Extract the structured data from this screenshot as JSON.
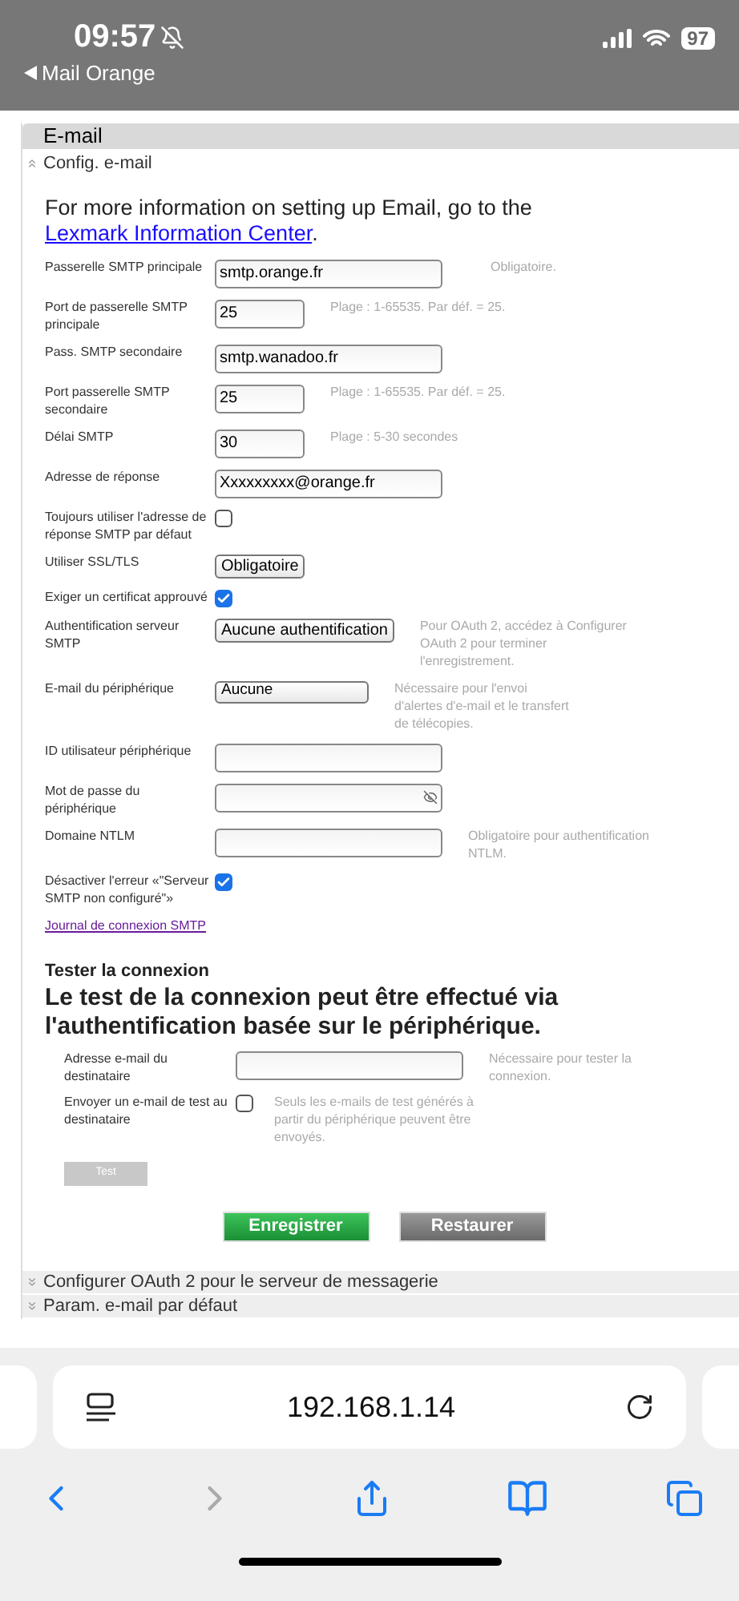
{
  "status_bar": {
    "time": "09:57",
    "back_app": "Mail Orange",
    "battery": "97"
  },
  "page": {
    "title": "E-mail",
    "sections": [
      {
        "title": "Config. e-mail",
        "expanded": true
      }
    ],
    "intro": "For more information on setting up Email, go to the",
    "intro_link": "Lexmark Information Center",
    "intro_end": ".",
    "fields": [
      {
        "label": "Passerelle SMTP principale",
        "kind": "text",
        "value": "smtp.orange.fr",
        "hint": "Obligatoire."
      },
      {
        "label": "Port de passerelle SMTP principale",
        "kind": "number",
        "value": "25",
        "hint": "Plage : 1-65535. Par déf. = 25."
      },
      {
        "label": "Pass. SMTP secondaire",
        "kind": "text",
        "value": "smtp.wanadoo.fr"
      },
      {
        "label": "Port passerelle SMTP secondaire",
        "kind": "number",
        "value": "25",
        "hint": "Plage : 1-65535. Par déf. = 25."
      },
      {
        "label": "Délai SMTP",
        "kind": "number",
        "value": "30",
        "hint": "Plage : 5-30 secondes"
      },
      {
        "label": "Adresse de réponse",
        "kind": "text",
        "value": "Xxxxxxxxx@orange.fr"
      },
      {
        "label": "Toujours utiliser l'adresse de réponse SMTP par défaut",
        "kind": "checkbox",
        "checked": false
      },
      {
        "label": "Utiliser SSL/TLS",
        "kind": "select",
        "value": "Obligatoire"
      },
      {
        "label": "Exiger un certificat approuvé",
        "kind": "checkbox",
        "checked": true
      },
      {
        "label": "Authentification serveur SMTP",
        "kind": "select",
        "value": "Aucune authentification",
        "hint": "Pour OAuth 2, accédez à Configurer OAuth 2 pour terminer l'enregistrement."
      },
      {
        "label": "E-mail du périphérique",
        "kind": "dropdown",
        "value": "Aucune",
        "hint": "Nécessaire pour l'envoi d'alertes d'e-mail et le transfert de télécopies."
      },
      {
        "label": "ID utilisateur périphérique",
        "kind": "text"
      },
      {
        "label": "Mot de passe du périphérique",
        "kind": "password"
      },
      {
        "label": "Domaine NTLM",
        "kind": "text",
        "hint": "Obligatoire pour authentification NTLM."
      },
      {
        "label": "Désactiver l'erreur «\"Serveur SMTP non configuré\"»",
        "kind": "checkbox",
        "checked": true
      }
    ],
    "log_link": "Journal de connexion SMTP",
    "test": {
      "title": "Tester la connexion",
      "heading": "Le test de la connexion peut être effectué via l'authentification basée sur le périphérique.",
      "fields": [
        {
          "label": "Adresse e-mail du destinataire",
          "kind": "text",
          "hint": "Nécessaire pour tester la connexion."
        },
        {
          "label": "Envoyer un e-mail de test au destinataire",
          "kind": "checkbox",
          "checked": false,
          "hint": "Seuls les e-mails de test générés à partir du périphérique peuvent être envoyés."
        }
      ],
      "button": {
        "label": "Test",
        "disabled": true
      }
    },
    "buttons": [
      {
        "label": "Enregistrer",
        "kind": "primary"
      },
      {
        "label": "Restaurer",
        "kind": "secondary"
      }
    ],
    "collapsed_sections": [
      {
        "title": "Configurer OAuth 2 pour le serveur de messagerie",
        "expanded": false
      },
      {
        "title": "Param. e-mail par défaut",
        "expanded": false
      }
    ]
  },
  "browser": {
    "url": "192.168.1.14"
  }
}
